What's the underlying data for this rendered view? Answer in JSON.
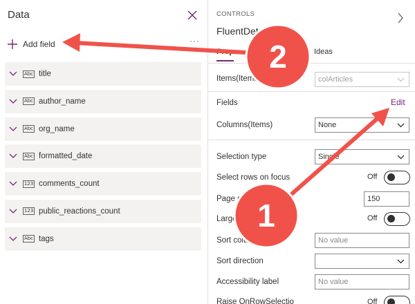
{
  "left": {
    "title": "Data",
    "add_field_label": "Add field",
    "more_label": "···",
    "fields": [
      {
        "name": "title",
        "type": "Abc"
      },
      {
        "name": "author_name",
        "type": "Abc"
      },
      {
        "name": "org_name",
        "type": "Abc"
      },
      {
        "name": "formatted_date",
        "type": "Abc"
      },
      {
        "name": "comments_count",
        "type": "123"
      },
      {
        "name": "public_reactions_count",
        "type": "123"
      },
      {
        "name": "tags",
        "type": "Abc"
      }
    ]
  },
  "right": {
    "caption": "CONTROLS",
    "control_name": "FluentDetai",
    "tabs": {
      "properties": "Prop",
      "ideas": "Ideas"
    },
    "items_label": "Items(Items)",
    "items_value": "colArticles",
    "fields_label": "Fields",
    "edit_label": "Edit",
    "columns_label": "Columns(Items)",
    "columns_value": "None",
    "selection_type_label": "Selection type",
    "selection_type_value": "Single",
    "select_rows_label": "Select rows on focus",
    "select_rows_value": "Off",
    "page_size_label": "Page si",
    "page_size_value": "150",
    "large_label": "Large",
    "large_value": "Off",
    "sort_column_label": "Sort colu",
    "sort_column_placeholder": "No value",
    "sort_direction_label": "Sort direction",
    "sort_direction_value": "",
    "accessibility_label": "Accessibility label",
    "accessibility_placeholder": "No value",
    "raise_label": "Raise OnRowSelectio",
    "raise_value": "Off"
  },
  "annotations": {
    "callout_1": "1",
    "callout_2": "2"
  },
  "colors": {
    "accent": "#742774",
    "callout": "#f0524a",
    "row_bg": "#f3f2f1"
  }
}
